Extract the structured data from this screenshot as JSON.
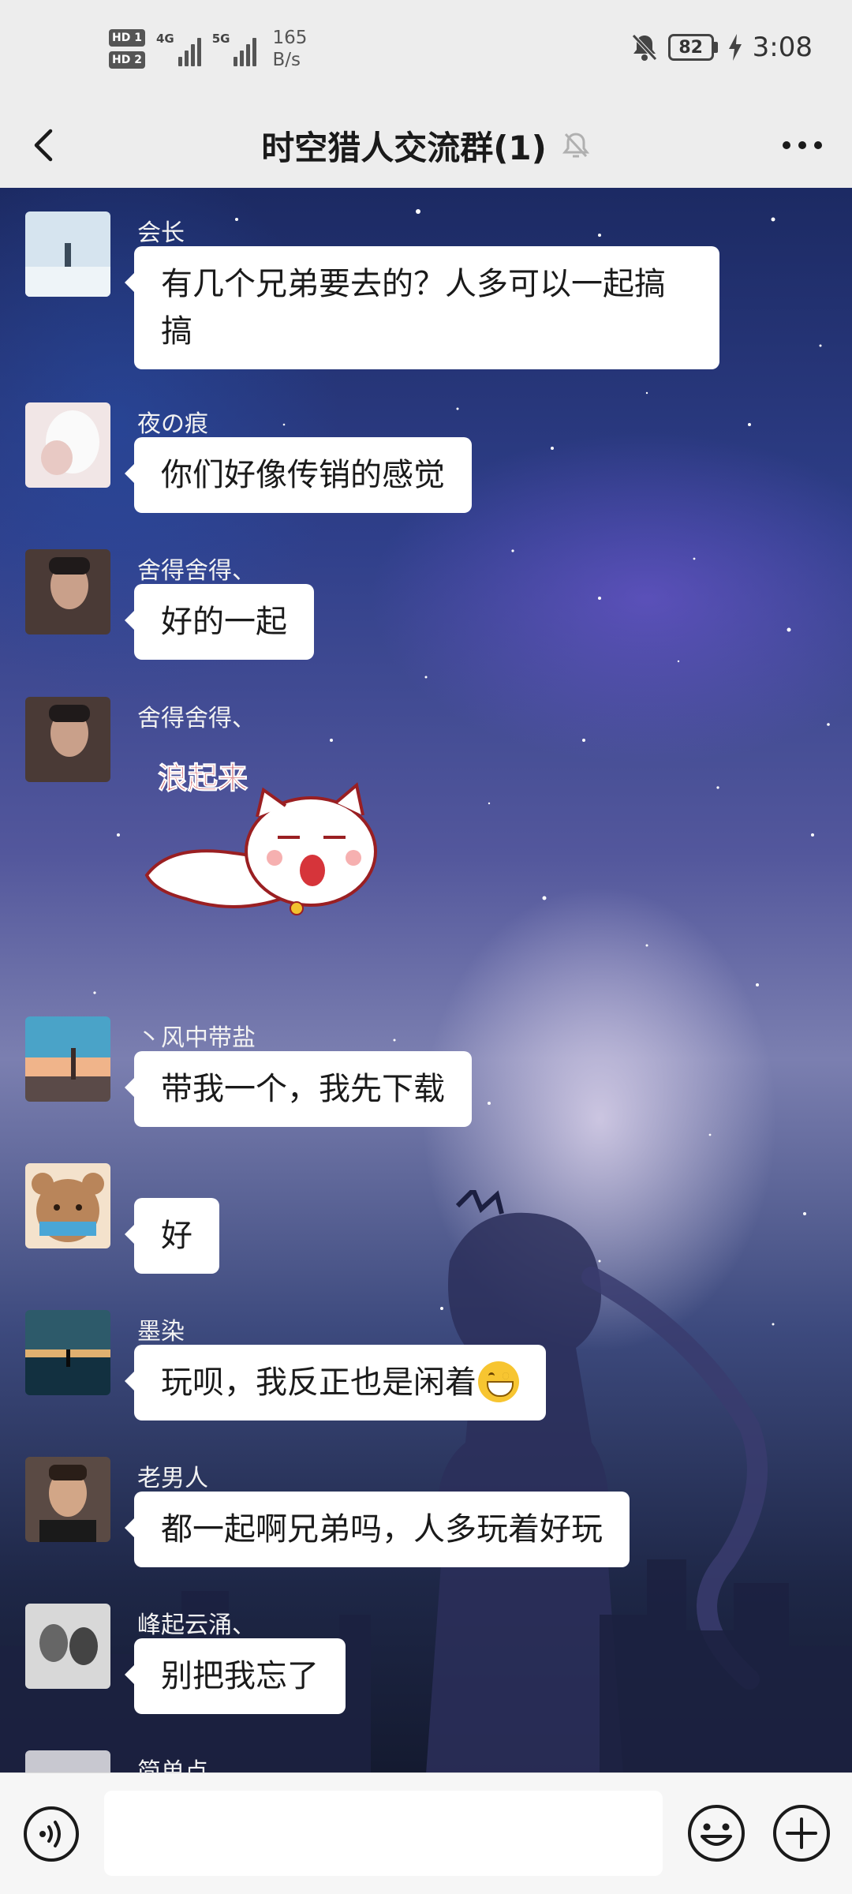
{
  "status_bar": {
    "sim1": "HD 1",
    "sim2": "HD 2",
    "net1": "4G",
    "net2": "5G",
    "speed_value": "165",
    "speed_unit": "B/s",
    "battery": "82",
    "time": "3:08",
    "icons": [
      "mute-bell-icon",
      "battery-icon",
      "charging-bolt-icon"
    ]
  },
  "header": {
    "title": "时空猎人交流群(1)",
    "icons": [
      "back-arrow-icon",
      "muted-bell-icon",
      "more-dots-icon"
    ]
  },
  "messages": [
    {
      "nickname": "会长",
      "text": "有几个兄弟要去的？人多可以一起搞搞"
    },
    {
      "nickname": "夜の痕",
      "text": "你们好像传销的感觉"
    },
    {
      "nickname": "舍得舍得、",
      "text": "好的一起"
    },
    {
      "nickname": "舍得舍得、",
      "sticker_caption": "浪起来",
      "sticker": "flying-cat-sticker"
    },
    {
      "nickname": "丶风中带盐",
      "text": "带我一个，我先下载"
    },
    {
      "nickname": "",
      "text": "好"
    },
    {
      "nickname": "墨染",
      "text": "玩呗，我反正也是闲着",
      "emoji": "grinning-face-emoji"
    },
    {
      "nickname": "老男人",
      "text": "都一起啊兄弟吗，人多玩着好玩"
    },
    {
      "nickname": "峰起云涌、",
      "text": "别把我忘了"
    },
    {
      "nickname": "简单点",
      "text": ""
    }
  ],
  "input_bar": {
    "placeholder": "",
    "icons": [
      "voice-icon",
      "emoji-face-icon",
      "plus-icon"
    ]
  }
}
